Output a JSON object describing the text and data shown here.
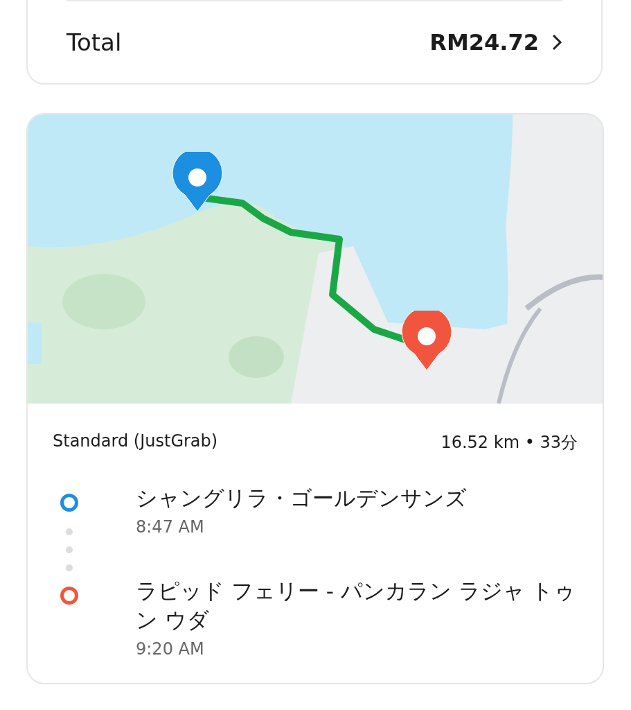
{
  "summary": {
    "label": "Total",
    "amount": "RM24.72"
  },
  "trip": {
    "service": "Standard (JustGrab)",
    "distance": "16.52 km • 33分",
    "stops": [
      {
        "name": "シャングリラ・ゴールデンサンズ",
        "time": "8:47 AM",
        "color": "#1d8fe1"
      },
      {
        "name": "ラピッド フェリー - パンカラン ラジャ トゥン ウダ",
        "time": "9:20 AM",
        "color": "#f2553d"
      }
    ]
  }
}
